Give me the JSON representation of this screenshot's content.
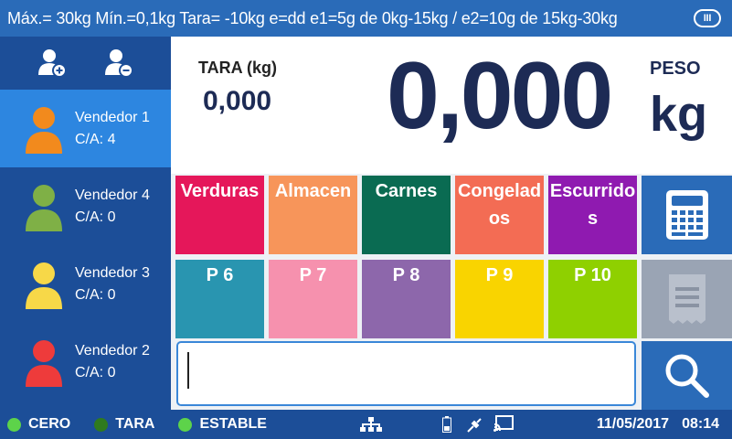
{
  "header": {
    "spec": "Máx.= 30kg  Mín.=0,1kg  Tara= -10kg  e=dd  e1=5g de 0kg-15kg / e2=10g de 15kg-30kg",
    "class_badge": "III"
  },
  "sellers": [
    {
      "name": "Vendedor 1",
      "count": "C/A: 4",
      "color": "#f28a1d",
      "active": true
    },
    {
      "name": "Vendedor 4",
      "count": "C/A: 0",
      "color": "#7fb046",
      "active": false
    },
    {
      "name": "Vendedor 3",
      "count": "C/A: 0",
      "color": "#f7d848",
      "active": false
    },
    {
      "name": "Vendedor 2",
      "count": "C/A: 0",
      "color": "#ee3b3b",
      "active": false
    }
  ],
  "display": {
    "tara_label": "TARA (kg)",
    "tara_value": "0,000",
    "weight": "0,000",
    "peso_label": "PESO",
    "unit": "kg"
  },
  "categories": [
    {
      "label": "Verduras",
      "color": "#e5175a"
    },
    {
      "label": "Almacen",
      "color": "#f7955a"
    },
    {
      "label": "Carnes",
      "color": "#0a6b52"
    },
    {
      "label": "Congelados",
      "color": "#f36c54"
    },
    {
      "label": "Escurridos",
      "color": "#8f1ab0"
    }
  ],
  "presets": [
    {
      "label": "P 6",
      "color": "#2995b0"
    },
    {
      "label": "P 7",
      "color": "#f691ae"
    },
    {
      "label": "P 8",
      "color": "#8d67ab"
    },
    {
      "label": "P 9",
      "color": "#f9d400"
    },
    {
      "label": "P 10",
      "color": "#8fd000"
    }
  ],
  "icons": {
    "add_user": "user-plus-icon",
    "remove_user": "user-minus-icon",
    "calculator": "calculator-icon",
    "receipt": "receipt-icon",
    "search": "search-icon",
    "network": "network-icon",
    "battery": "battery-icon",
    "plug": "plug-icon",
    "cast": "cast-icon"
  },
  "status": {
    "cero": "CERO",
    "tara": "TARA",
    "estable": "ESTABLE",
    "date": "11/05/2017",
    "time": "08:14",
    "led_on": "#5dd34a",
    "led_off": "#2f7a1e"
  },
  "colors": {
    "side_button": "#2a6bb8",
    "receipt_disabled": "#9aa4b4"
  }
}
